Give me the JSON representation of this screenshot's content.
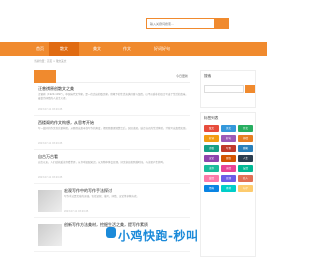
{
  "search": {
    "placeholder": "输入关键词搜索..."
  },
  "nav": [
    {
      "label": "首页"
    },
    {
      "label": "散文"
    },
    {
      "label": "美文"
    },
    {
      "label": "作文"
    },
    {
      "label": "好词好句"
    }
  ],
  "breadcrumb": "当前位置：首页 > 散文美文",
  "main": {
    "latest_label": "今日更新",
    "articles": [
      {
        "title": "汪曾祺原创散文之美",
        "excerpt": "汪曾祺（1920-1997），中国当代文学家，是一位杰出的散文家。他笔下的生活充满诗意与温情，以平淡质朴的语言写出了生活的真味，被誉为抒情的人道主义者。",
        "meta": "2023-07-11 03:29:25"
      },
      {
        "title": "西楼阁的作文构想，从思考开始",
        "excerpt": "写一篇好的作文首先要构思，从题目出发寻找写作的角度，把思路整理清楚之后，层层递进，结合自己的生活体验，才能写出真情实感。",
        "meta": "2023-07-11 03:29:25"
      },
      {
        "title": "自古万古看",
        "excerpt": "自古以来，人们就热爱读书看世界，从书中汲取知识，从万物中体会哲理，好文章总能跨越时间，与读者产生共鸣。",
        "meta": "2023-07-11 03:29:25"
      },
      {
        "title": "宏观写作中的写作手法探讨",
        "excerpt": "写作手法是文章的灵魂，包括记叙、描写、抒情、议论等多种方式。",
        "meta": "2023-07-11 03:29:25"
      },
      {
        "title": "创新写作方法美材，挖掘生活之美，提写作素质",
        "excerpt": "",
        "meta": ""
      }
    ]
  },
  "sidebar": {
    "search_label": "搜索",
    "tags_label": "标签列表",
    "tags": [
      {
        "label": "散文",
        "color": "#e74c3c"
      },
      {
        "label": "美文",
        "color": "#3498db"
      },
      {
        "label": "作文",
        "color": "#27ae60"
      },
      {
        "label": "好词",
        "color": "#f39c12"
      },
      {
        "label": "好句",
        "color": "#9b59b6"
      },
      {
        "label": "抒情",
        "color": "#e67e22"
      },
      {
        "label": "诗歌",
        "color": "#16a085"
      },
      {
        "label": "写景",
        "color": "#c0392b"
      },
      {
        "label": "随笔",
        "color": "#2980b9"
      },
      {
        "label": "议论",
        "color": "#8e44ad"
      },
      {
        "label": "感悟",
        "color": "#d35400"
      },
      {
        "label": "人生",
        "color": "#2c3e50"
      },
      {
        "label": "读书",
        "color": "#1abc9c"
      },
      {
        "label": "亲情",
        "color": "#e84393"
      },
      {
        "label": "友情",
        "color": "#00b894"
      },
      {
        "label": "爱情",
        "color": "#fd79a8"
      },
      {
        "label": "哲理",
        "color": "#6c5ce7"
      },
      {
        "label": "名人",
        "color": "#e17055"
      },
      {
        "label": "经典",
        "color": "#0984e3"
      },
      {
        "label": "素材",
        "color": "#00cec9"
      },
      {
        "label": "句子",
        "color": "#fdcb6e"
      }
    ]
  },
  "watermark": {
    "text": "小鸡快跑-秒叫"
  },
  "colors": {
    "accent": "#f08a2e",
    "accent_dark": "#e06b12",
    "watermark": "#1b8ad9"
  }
}
